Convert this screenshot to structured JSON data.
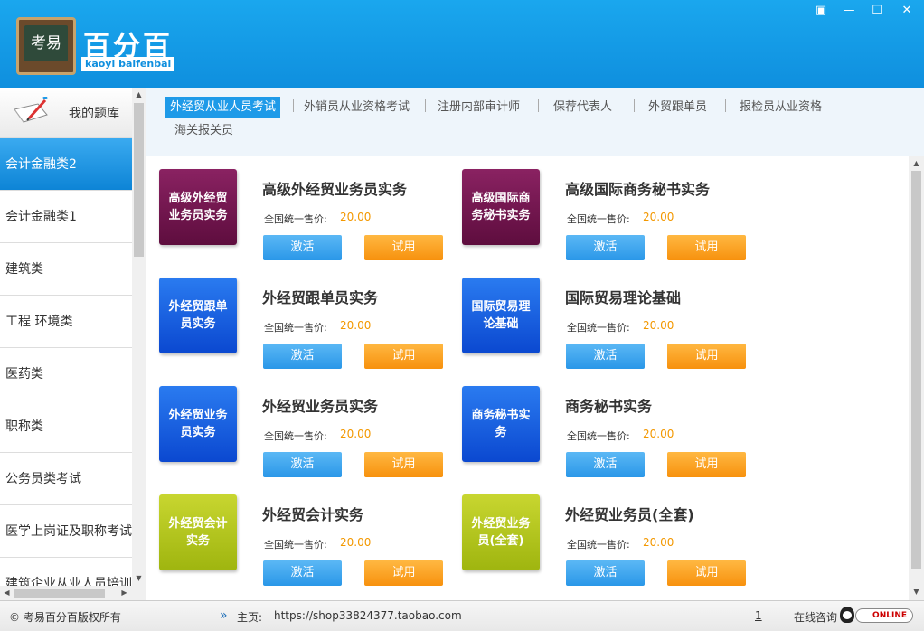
{
  "header": {
    "logo_badge": "考易",
    "brand": "百分百",
    "brand_sub": "kaoyi baifenbai",
    "window_controls": [
      "▣",
      "—",
      "☐",
      "✕"
    ]
  },
  "sidebar": {
    "title": "我的题库",
    "items": [
      {
        "label": "会计金融类2"
      },
      {
        "label": "会计金融类1"
      },
      {
        "label": "建筑类"
      },
      {
        "label": "工程  环境类"
      },
      {
        "label": "医药类"
      },
      {
        "label": "职称类"
      },
      {
        "label": "公务员类考试"
      },
      {
        "label": "医学上岗证及职称考试"
      },
      {
        "label": "建筑企业从业人员培训"
      }
    ]
  },
  "tabs": [
    {
      "label": "外经贸从业人员考试"
    },
    {
      "label": "外销员从业资格考试"
    },
    {
      "label": "注册内部审计师"
    },
    {
      "label": "保荐代表人"
    },
    {
      "label": "外贸跟单员"
    },
    {
      "label": "报检员从业资格"
    },
    {
      "label": "海关报关员"
    }
  ],
  "products": [
    {
      "cover": "高级外经贸业务员实务",
      "title": "高级外经贸业务员实务",
      "color": "purple"
    },
    {
      "cover": "高级国际商务秘书实务",
      "title": "高级国际商务秘书实务",
      "color": "purple"
    },
    {
      "cover": "外经贸跟单员实务",
      "title": "外经贸跟单员实务",
      "color": "blue"
    },
    {
      "cover": "国际贸易理论基础",
      "title": "国际贸易理论基础",
      "color": "blue"
    },
    {
      "cover": "外经贸业务员实务",
      "title": "外经贸业务员实务",
      "color": "blue"
    },
    {
      "cover": "商务秘书实务",
      "title": "商务秘书实务",
      "color": "blue"
    },
    {
      "cover": "外经贸会计实务",
      "title": "外经贸会计实务",
      "color": "green"
    },
    {
      "cover": "外经贸业务员(全套)",
      "title": "外经贸业务员(全套)",
      "color": "green"
    }
  ],
  "price_label": "全国统一售价:",
  "price_value": "20.00",
  "activate_label": "激活",
  "trial_label": "试用",
  "footer": {
    "copyright": "© 考易百分百版权所有",
    "homepage_label": "主页:",
    "homepage_url": "https://shop33824377.taobao.com",
    "page_number": "1",
    "online_consult": "在线咨询",
    "online_badge": "ONLINE"
  },
  "colors": {
    "header_blue": "#1aa7ee",
    "active_tab": "#1e9ae8",
    "price_orange": "#f39800",
    "activate_button": "#2a97e8",
    "trial_button": "#f7910d"
  }
}
